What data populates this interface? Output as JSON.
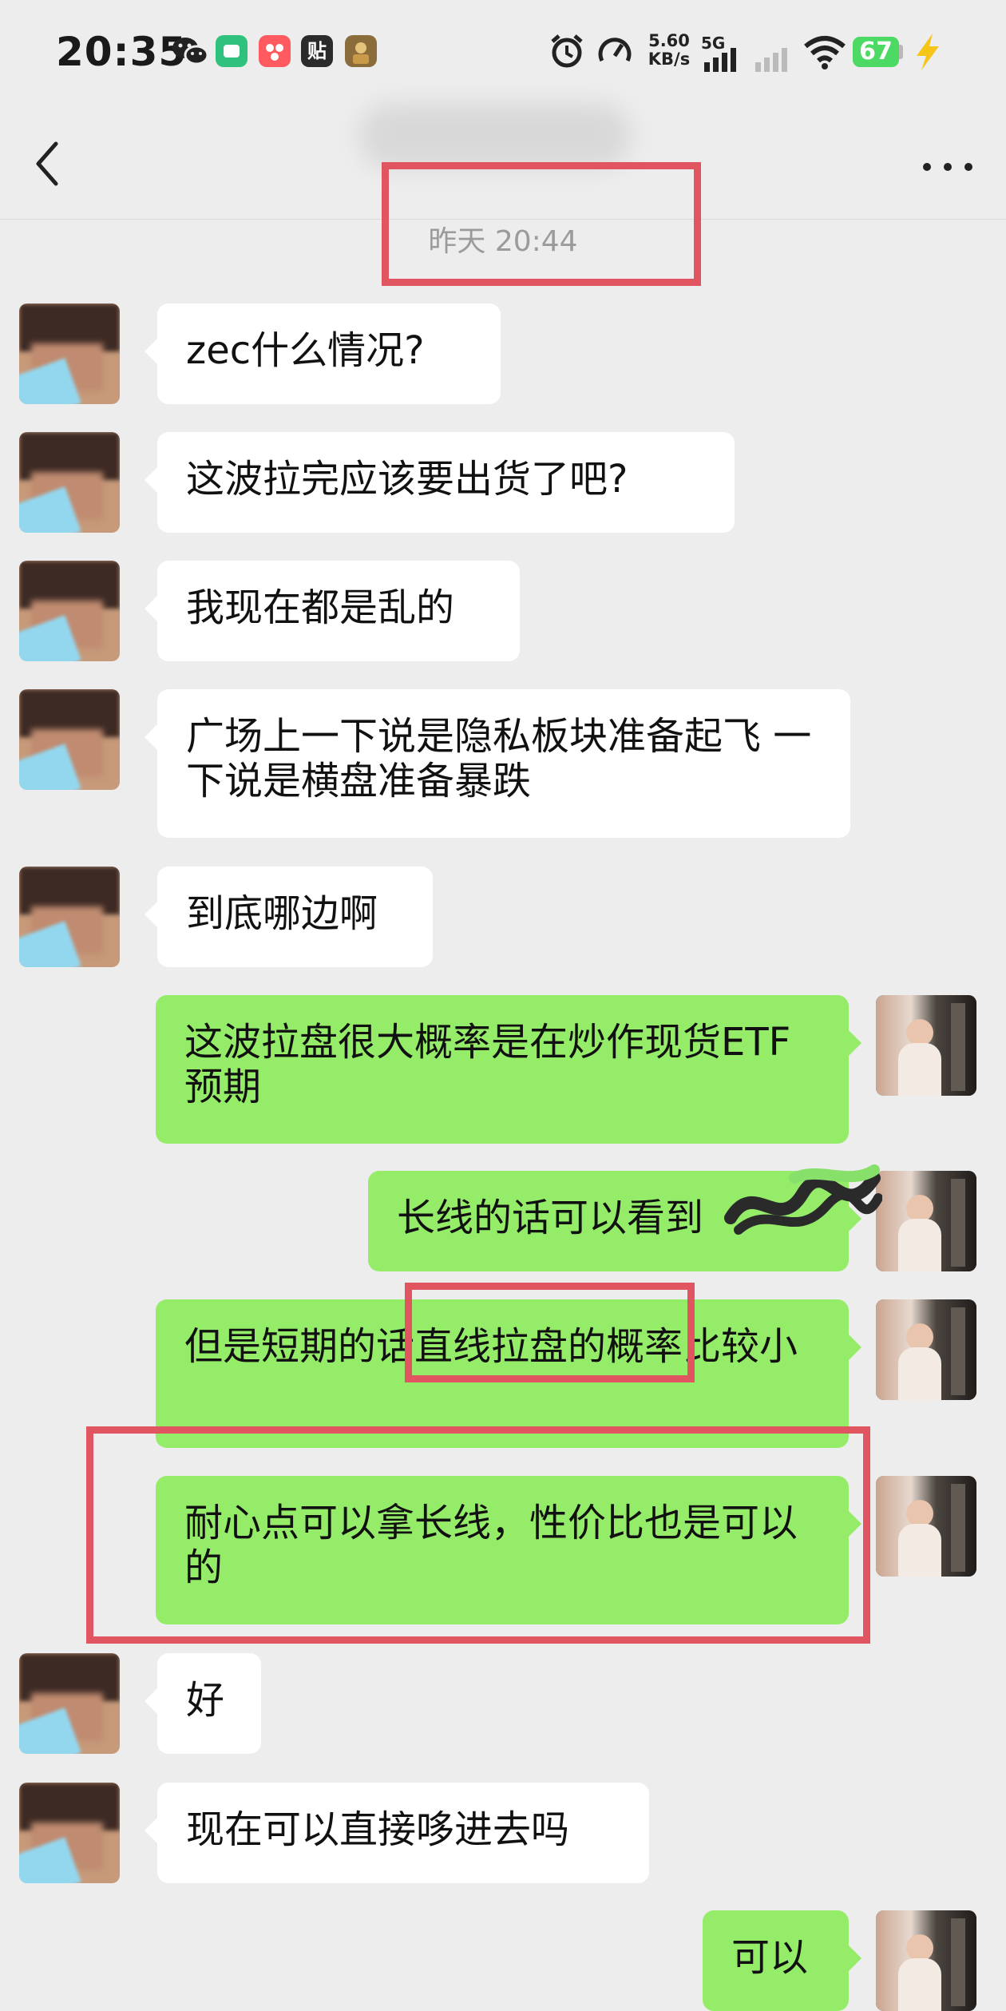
{
  "status_bar": {
    "time": "20:35",
    "app_icons": [
      "wechat-icon",
      "game-app-icon",
      "camera-app-icon",
      "tieba-app-icon",
      "pubg-app-icon"
    ],
    "tieba_label": "贴",
    "net_speed_value": "5.60",
    "net_speed_unit": "KB/s",
    "signal_label": "5G",
    "battery_level": "67"
  },
  "chat": {
    "contact_name_blurred": true,
    "timestamp": "昨天 20:44",
    "messages": [
      {
        "side": "in",
        "text": "zec什么情况?"
      },
      {
        "side": "in",
        "text": "这波拉完应该要出货了吧?"
      },
      {
        "side": "in",
        "text": "我现在都是乱的"
      },
      {
        "side": "in",
        "text": "广场上一下说是隐私板块准备起飞 一下说是横盘准备暴跌"
      },
      {
        "side": "in",
        "text": "到底哪边啊"
      },
      {
        "side": "out",
        "text": "这波拉盘很大概率是在炒作现货ETF预期"
      },
      {
        "side": "out",
        "text": "长线的话可以看到"
      },
      {
        "side": "out",
        "text": "但是短期的话直线拉盘的概率比较小"
      },
      {
        "side": "out",
        "text": "耐心点可以拿长线，性价比也是可以的"
      },
      {
        "side": "in",
        "text": "好"
      },
      {
        "side": "in",
        "text": "现在可以直接哆进去吗"
      },
      {
        "side": "out",
        "text": "可以"
      }
    ]
  },
  "colors": {
    "background": "#ededed",
    "outgoing_bubble": "#95ec69",
    "incoming_bubble": "#ffffff",
    "highlight_box": "#e0555f",
    "battery": "#4cd964"
  }
}
